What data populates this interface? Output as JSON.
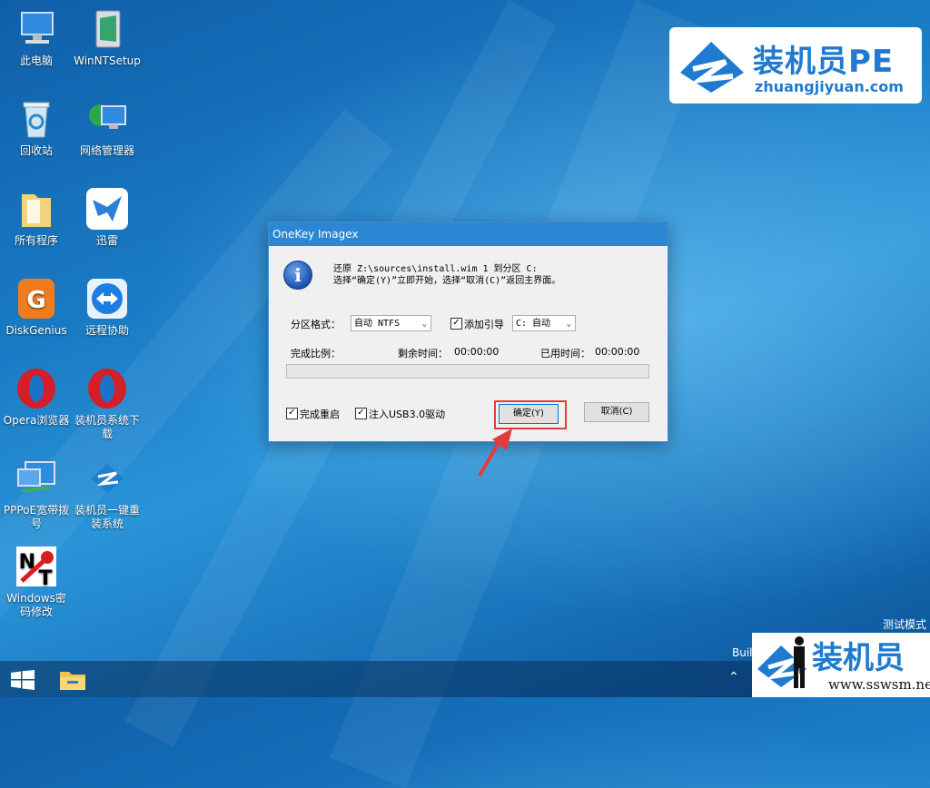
{
  "desktop_icons": [
    {
      "id": "computer",
      "label": "此电脑",
      "icon": "computer-icon"
    },
    {
      "id": "winntsetup",
      "label": "WinNTSetup",
      "icon": "winntsetup-icon"
    },
    {
      "id": "recycle",
      "label": "回收站",
      "icon": "recycle-bin-icon"
    },
    {
      "id": "network",
      "label": "网络管理器",
      "icon": "network-manager-icon"
    },
    {
      "id": "programs",
      "label": "所有程序",
      "icon": "folder-icon"
    },
    {
      "id": "xunlei",
      "label": "迅雷",
      "icon": "xunlei-icon"
    },
    {
      "id": "diskgenius",
      "label": "DiskGenius",
      "icon": "diskgenius-icon"
    },
    {
      "id": "remote",
      "label": "远程协助",
      "icon": "teamviewer-icon"
    },
    {
      "id": "opera",
      "label": "Opera浏览器",
      "icon": "opera-icon"
    },
    {
      "id": "download",
      "label": "装机员系统下载",
      "icon": "opera-icon"
    },
    {
      "id": "pppoe",
      "label": "PPPoE宽带拨号",
      "icon": "pppoe-icon"
    },
    {
      "id": "reinstall",
      "label": "装机员一键重装系统",
      "icon": "zhuangjiyuan-icon"
    },
    {
      "id": "ntpwedit",
      "label": "Windows密码修改",
      "icon": "nt-key-icon"
    }
  ],
  "logo": {
    "brand": "装机员PE",
    "url": "zhuangjiyuan.com",
    "color": "#1f7ad0"
  },
  "dialog": {
    "title": "OneKey Imagex",
    "message_line1": "还原 Z:\\sources\\install.wim 1 到分区 C:",
    "message_line2": "选择“确定(Y)”立即开始，选择“取消(C)”返回主界面。",
    "partition_format_label": "分区格式：",
    "partition_format_value": "自动 NTFS",
    "add_boot_label": "添加引导",
    "add_boot_checked": true,
    "boot_target_value": "C: 自动",
    "progress_label": "完成比例：",
    "remaining_label": "剩余时间：",
    "remaining_value": "00:00:00",
    "elapsed_label": "已用时间：",
    "elapsed_value": "00:00:00",
    "progress_fraction": 0,
    "reboot_label": "完成重启",
    "reboot_checked": true,
    "usb3_label": "注入USB3.0驱动",
    "usb3_checked": true,
    "ok_label": "确定(Y)",
    "cancel_label": "取消(C)"
  },
  "system": {
    "test_mode": "测试模式",
    "build": "Buil"
  },
  "watermark": {
    "brand": "装机员",
    "url": "www.sswsm.net"
  },
  "colors": {
    "highlight": "#e53b3b",
    "titlebar": "#2b87d3"
  }
}
